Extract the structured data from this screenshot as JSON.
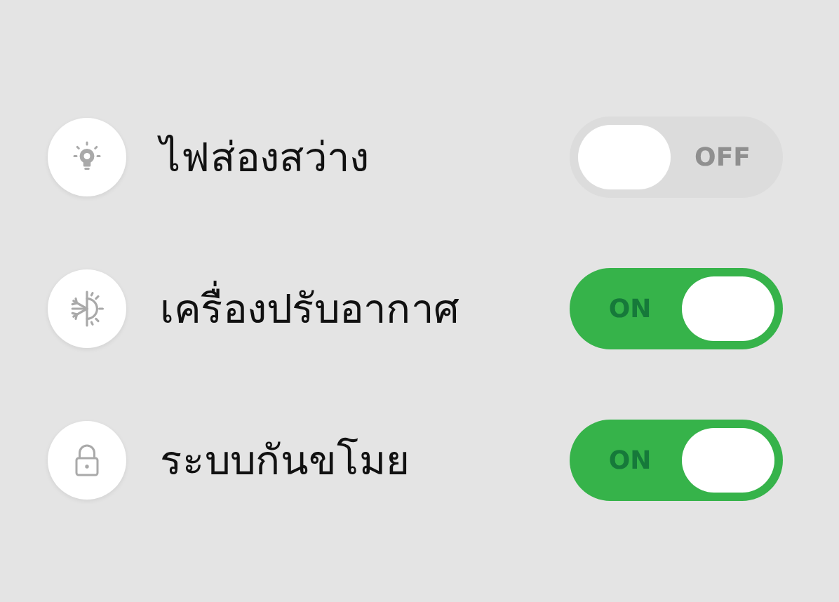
{
  "items": [
    {
      "label": "ไฟส่องสว่าง",
      "on": false,
      "switch_text": "OFF"
    },
    {
      "label": "เครื่องปรับอากาศ",
      "on": true,
      "switch_text": "ON"
    },
    {
      "label": "ระบบกันขโมย",
      "on": true,
      "switch_text": "ON"
    }
  ]
}
